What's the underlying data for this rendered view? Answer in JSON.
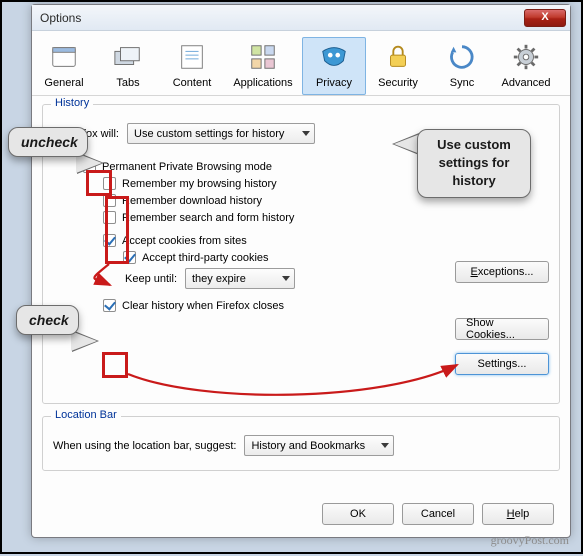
{
  "window": {
    "title": "Options",
    "close": "X"
  },
  "tabs": {
    "general": {
      "label": "General"
    },
    "tabs": {
      "label": "Tabs"
    },
    "content": {
      "label": "Content"
    },
    "applications": {
      "label": "Applications"
    },
    "privacy": {
      "label": "Privacy"
    },
    "security": {
      "label": "Security"
    },
    "sync": {
      "label": "Sync"
    },
    "advanced": {
      "label": "Advanced"
    }
  },
  "history": {
    "legend": "History",
    "will_label": "Firefox will:",
    "will_value": "Use custom settings for history",
    "ppb_label": "Permanent Private Browsing mode",
    "ppb_checked": false,
    "remember_hist_label": "Remember my browsing history",
    "remember_hist_checked": false,
    "remember_dl_label": "Remember download history",
    "remember_dl_checked": false,
    "remember_form_label": "Remember search and form history",
    "remember_form_checked": false,
    "accept_cookies_label": "Accept cookies from sites",
    "accept_cookies_checked": true,
    "accept_third_label": "Accept third-party cookies",
    "accept_third_checked": true,
    "keep_label": "Keep until:",
    "keep_value": "they expire",
    "clear_on_close_label": "Clear history when Firefox closes",
    "clear_on_close_checked": true,
    "exceptions_btn": "Exceptions...",
    "show_cookies_btn": "Show Cookies...",
    "settings_btn": "Settings..."
  },
  "location": {
    "legend": "Location Bar",
    "suggest_label": "When using the location bar, suggest:",
    "suggest_value": "History and Bookmarks"
  },
  "footer": {
    "ok": "OK",
    "cancel": "Cancel",
    "help": "Help"
  },
  "annotations": {
    "uncheck": "uncheck",
    "check": "check",
    "big": "Use custom settings for history"
  },
  "watermark": "groovyPost.com"
}
